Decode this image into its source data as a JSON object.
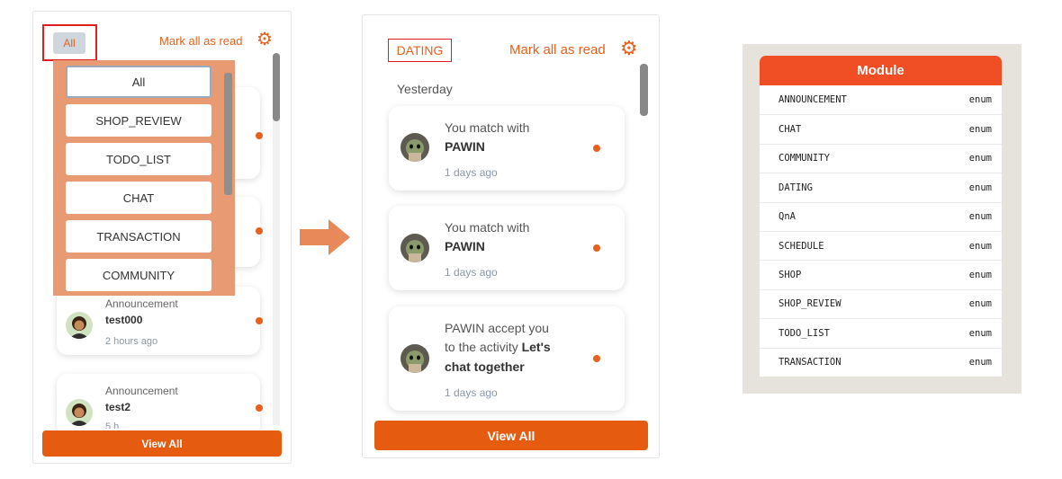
{
  "panel_all": {
    "filter_label": "All",
    "mark_all_label": "Mark all as read",
    "dropdown_options": [
      "All",
      "SHOP_REVIEW",
      "TODO_LIST",
      "CHAT",
      "TRANSACTION",
      "COMMUNITY"
    ],
    "notifications": [
      {
        "type": "Announcement",
        "title": "test000",
        "time": "2 hours ago"
      },
      {
        "type": "Announcement",
        "title": "test2",
        "time": "5 h"
      }
    ],
    "view_all_label": "View All"
  },
  "panel_dating": {
    "filter_label": "DATING",
    "mark_all_label": "Mark all as read",
    "section_label": "Yesterday",
    "notifications": [
      {
        "line1": "You match with",
        "bold": "PAWIN",
        "time": "1 days ago"
      },
      {
        "line1": "You match with",
        "bold": "PAWIN",
        "time": "1 days ago"
      },
      {
        "line1": "PAWIN accept you",
        "line2_prefix": "to the activity ",
        "line2_bold": "Let's",
        "line3_bold": "chat together",
        "time": "1 days ago"
      }
    ],
    "view_all_label": "View All"
  },
  "module_table": {
    "header": "Module",
    "rows": [
      {
        "name": "ANNOUNCEMENT",
        "type": "enum"
      },
      {
        "name": "CHAT",
        "type": "enum"
      },
      {
        "name": "COMMUNITY",
        "type": "enum"
      },
      {
        "name": "DATING",
        "type": "enum"
      },
      {
        "name": "QnA",
        "type": "enum"
      },
      {
        "name": "SCHEDULE",
        "type": "enum"
      },
      {
        "name": "SHOP",
        "type": "enum"
      },
      {
        "name": "SHOP_REVIEW",
        "type": "enum"
      },
      {
        "name": "TODO_LIST",
        "type": "enum"
      },
      {
        "name": "TRANSACTION",
        "type": "enum"
      }
    ]
  },
  "colors": {
    "accent": "#e8601c",
    "button": "#e55c10",
    "dropdown_bg": "#e89a72",
    "table_header": "#f04e24",
    "highlight_box": "#e02020"
  },
  "icons": [
    "gear-icon",
    "avatar-icon",
    "unread-dot-icon",
    "right-arrow-icon"
  ]
}
